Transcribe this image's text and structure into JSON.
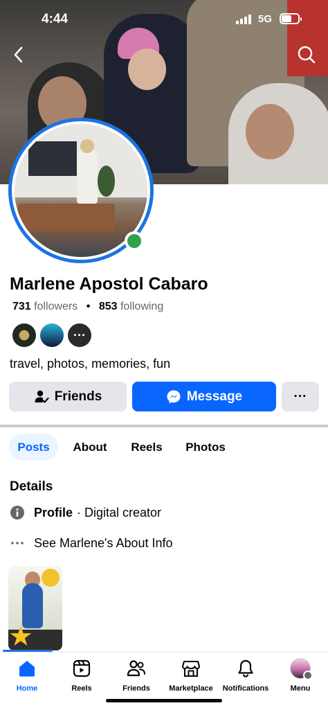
{
  "status_bar": {
    "time": "4:44",
    "network": "5G"
  },
  "profile": {
    "name": "Marlene Apostol Cabaro",
    "followers_count": "731",
    "followers_label": "followers",
    "following_count": "853",
    "following_label": "following",
    "bio": "travel, photos, memories, fun",
    "online": true
  },
  "actions": {
    "friends_label": "Friends",
    "message_label": "Message",
    "more_label": "···"
  },
  "tabs": [
    {
      "label": "Posts",
      "active": true
    },
    {
      "label": "About",
      "active": false
    },
    {
      "label": "Reels",
      "active": false
    },
    {
      "label": "Photos",
      "active": false
    }
  ],
  "details": {
    "title": "Details",
    "profile_label": "Profile",
    "profile_value": "· Digital creator",
    "about_link": "See Marlene's About Info"
  },
  "bottom_nav": [
    {
      "label": "Home",
      "icon": "home-icon",
      "active": true
    },
    {
      "label": "Reels",
      "icon": "reels-icon",
      "active": false
    },
    {
      "label": "Friends",
      "icon": "friends-icon",
      "active": false
    },
    {
      "label": "Marketplace",
      "icon": "marketplace-icon",
      "active": false
    },
    {
      "label": "Notifications",
      "icon": "bell-icon",
      "active": false
    },
    {
      "label": "Menu",
      "icon": "menu-avatar",
      "active": false
    }
  ],
  "colors": {
    "accent": "#0866ff",
    "online": "#31a24c",
    "button_gray": "#e4e6eb",
    "secondary_text": "#65676b"
  }
}
